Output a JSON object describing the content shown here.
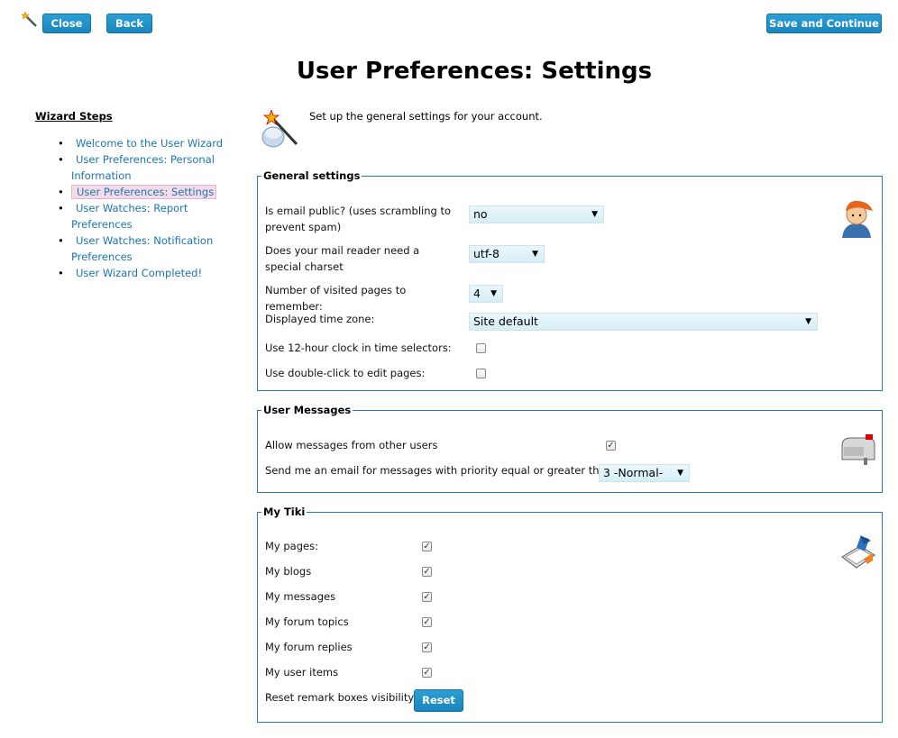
{
  "toolbar": {
    "close_label": "Close",
    "back_label": "Back",
    "save_label": "Save and Continue"
  },
  "page_title": "User Preferences: Settings",
  "wizard_steps": {
    "title": "Wizard Steps",
    "items": [
      {
        "label": "Welcome to the User Wizard"
      },
      {
        "label": "User Preferences: Personal Information"
      },
      {
        "label": "User Preferences: Settings",
        "active": true
      },
      {
        "label": "User Watches: Report Preferences"
      },
      {
        "label": "User Watches: Notification Preferences"
      },
      {
        "label": "User Wizard Completed!"
      }
    ]
  },
  "intro": "Set up the general settings for your account.",
  "general": {
    "legend": "General settings",
    "email_public": {
      "label": "Is email public? (uses scrambling to prevent spam)",
      "value": "no"
    },
    "charset": {
      "label": "Does your mail reader need a special charset",
      "value": "utf-8"
    },
    "visited": {
      "label": "Number of visited pages to remember:",
      "value": "4"
    },
    "timezone": {
      "label": "Displayed time zone:",
      "value": "Site default"
    },
    "clock12": {
      "label": "Use 12-hour clock in time selectors:",
      "checked": false
    },
    "dblclick": {
      "label": "Use double-click to edit pages:",
      "checked": false
    }
  },
  "messages": {
    "legend": "User Messages",
    "allow": {
      "label": "Allow messages from other users",
      "checked": true
    },
    "priority": {
      "label": "Send me an email for messages with priority equal or greater than:",
      "value": "3 -Normal-"
    }
  },
  "mytiki": {
    "legend": "My Tiki",
    "items": [
      {
        "label": "My pages:",
        "checked": true
      },
      {
        "label": "My blogs",
        "checked": true
      },
      {
        "label": "My messages",
        "checked": true
      },
      {
        "label": "My forum topics",
        "checked": true
      },
      {
        "label": "My forum replies",
        "checked": true
      },
      {
        "label": "My user items",
        "checked": true
      }
    ],
    "reset_label": "Reset remark boxes visibility",
    "reset_button": "Reset"
  },
  "colors": {
    "accent": "#1a86bd",
    "link": "#1b75b3",
    "fieldset_border": "#2a7ab0",
    "active_step_bg": "#f5dbe8"
  }
}
